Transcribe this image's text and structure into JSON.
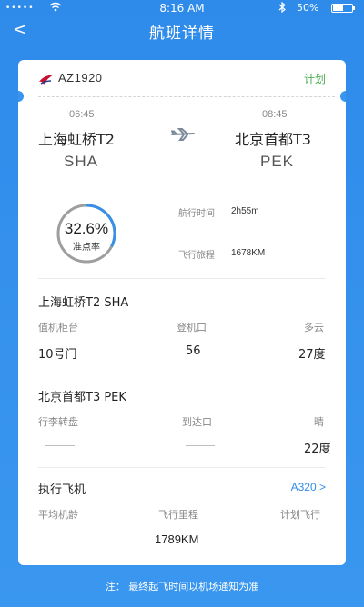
{
  "status_bar": {
    "signal": "•••••",
    "time": "8:16 AM",
    "battery": "50%",
    "battery_level": 0.5
  },
  "nav": {
    "back": "<",
    "title": "航班详情"
  },
  "flight": {
    "number": "AZ1920",
    "status": "计划",
    "status_color": "#4caf50",
    "departure": {
      "time": "06:45",
      "airport": "上海虹桥T2",
      "code": "SHA"
    },
    "arrival": {
      "time": "08:45",
      "airport": "北京首都T3",
      "code": "PEK"
    }
  },
  "stats": {
    "on_time_rate": "32.6%",
    "on_time_value": 0.326,
    "on_time_label": "准点率",
    "duration_label": "航行时间",
    "duration": "2h55m",
    "distance_label": "飞行旅程",
    "distance": "1678KM"
  },
  "departure_info": {
    "title": "上海虹桥T2 SHA",
    "labels": [
      "值机柜台",
      "登机口",
      "多云"
    ],
    "values": [
      "10号门",
      "56",
      "27度"
    ]
  },
  "arrival_info": {
    "title": "北京首都T3 PEK",
    "labels": [
      "行李转盘",
      "到达口",
      "晴"
    ],
    "values": [
      "",
      "",
      "22度"
    ]
  },
  "aircraft": {
    "title": "执行飞机",
    "model": "A320 >",
    "labels": [
      "平均机龄",
      "飞行里程",
      "计划飞行"
    ],
    "mileage": "1789KM"
  },
  "footer": {
    "note": "注：  最终起飞时间以机场通知为准"
  },
  "colors": {
    "accent": "#2f8bea",
    "ring_track": "#9e9e9e",
    "ring_progress": "#3a8fe6"
  }
}
